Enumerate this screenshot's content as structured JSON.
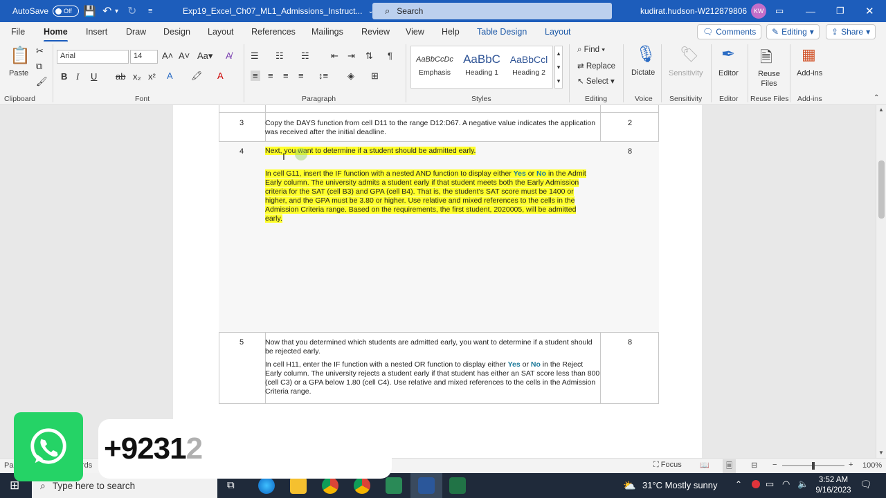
{
  "titlebar": {
    "autosave_label": "AutoSave",
    "autosave_state": "Off",
    "document_name": "Exp19_Excel_Ch07_ML1_Admissions_Instruct...",
    "search_label": "Search",
    "user_name": "kudirat.hudson-W212879806",
    "user_initials": "KW"
  },
  "tabs": {
    "file": "File",
    "home": "Home",
    "insert": "Insert",
    "draw": "Draw",
    "design": "Design",
    "layout": "Layout",
    "references": "References",
    "mailings": "Mailings",
    "review": "Review",
    "view": "View",
    "help": "Help",
    "table_design": "Table Design",
    "table_layout": "Layout",
    "comments": "Comments",
    "editing": "Editing",
    "share": "Share"
  },
  "ribbon": {
    "paste": "Paste",
    "clipboard": "Clipboard",
    "font_name": "Arial",
    "font_size": "14",
    "font": "Font",
    "paragraph": "Paragraph",
    "styles": [
      {
        "preview": "AaBbCcDc",
        "name": "Emphasis"
      },
      {
        "preview": "AaBbC",
        "name": "Heading 1"
      },
      {
        "preview": "AaBbCcl",
        "name": "Heading 2"
      }
    ],
    "styles_label": "Styles",
    "find": "Find",
    "replace": "Replace",
    "select": "Select",
    "editing_label": "Editing",
    "dictate": "Dictate",
    "voice": "Voice",
    "sensitivity": "Sensitivity",
    "sensitivity_label": "Sensitivity",
    "editor": "Editor",
    "editor_label": "Editor",
    "reuse_files": "Reuse Files",
    "reuse_files_label": "Reuse Files",
    "addins": "Add-ins",
    "addins_label": "Add-ins"
  },
  "table": {
    "row3": {
      "num": "3",
      "text": "Copy the DAYS function from cell D11 to the range D12:D67. A negative value indicates the application was received after the initial deadline.",
      "points": "2"
    },
    "row4": {
      "num": "4",
      "intro": "Next, you want to determine if a student should be admitted early.",
      "p_before_yes": "In cell G11, insert the IF function with a nested AND function to display either ",
      "yes": "Yes",
      "or": " or ",
      "no": "No",
      "p_after_no": " in the Admit Early column. The university admits a student early if that student meets both the Early Admission criteria for the SAT (cell B3) and GPA (cell B4). That is, the student’s SAT score must be 1400 or higher, and the GPA must be 3.80 or higher. Use relative and mixed references to the cells in the Admission Criteria range. Based on the requirements, the first student, 2020005, will be admitted early.",
      "points": "8"
    },
    "row5": {
      "num": "5",
      "intro": "Now that you determined which students are admitted early, you want to determine if a student should be rejected early.",
      "p_before_yes": "In cell H11, enter the IF function with a nested OR function to display either ",
      "yes": "Yes",
      "or": " or ",
      "no": "No",
      "p_after_no": " in the Reject Early column. The university rejects a student early if that student has either an SAT score less than 800 (cell C3) or a GPA below 1.80 (cell C4). Use relative and mixed references to the cells in the Admission Criteria range.",
      "points": "8"
    }
  },
  "statusbar": {
    "left_prefix": "Pa",
    "left_suffix": "rds",
    "focus": "Focus",
    "zoom": "100%"
  },
  "taskbar": {
    "search_placeholder": "Type here to search",
    "weather": "31°C  Mostly sunny",
    "time": "3:52 AM",
    "date": "9/16/2023"
  },
  "overlay": {
    "phone_visible": "+9231",
    "phone_faded": "2"
  },
  "colors": {
    "titlebar": "#1d5dbb",
    "highlight": "#ffff28",
    "whatsapp": "#25d366",
    "accent": "#185abd"
  }
}
